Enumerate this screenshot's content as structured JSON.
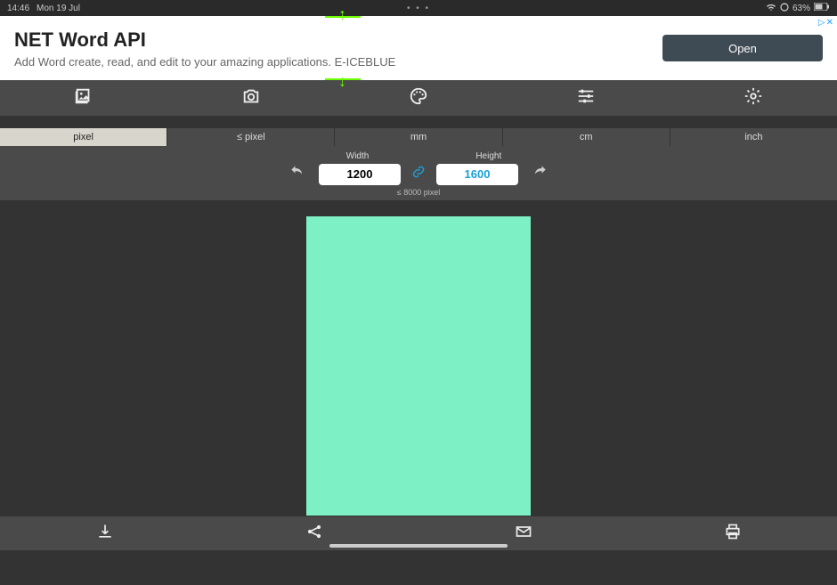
{
  "statusbar": {
    "time": "14:46",
    "date": "Mon 19 Jul",
    "dots": "• • •",
    "battery": "63%",
    "battery_icon": "■"
  },
  "ad": {
    "title": "NET Word API",
    "subtitle": "Add Word create, read, and edit to your amazing applications. E-ICEBLUE",
    "open_label": "Open",
    "badge_tri": "▷",
    "badge_x": "✕"
  },
  "units": {
    "items": [
      "pixel",
      "≤ pixel",
      "mm",
      "cm",
      "inch"
    ],
    "active_index": 0
  },
  "dimensions": {
    "width_label": "Width",
    "height_label": "Height",
    "width_value": "1200",
    "height_value": "1600",
    "hint": "≤ 8000 pixel"
  },
  "colors": {
    "canvas_fill": "#7df0c6",
    "accent": "#1aa0d8"
  }
}
